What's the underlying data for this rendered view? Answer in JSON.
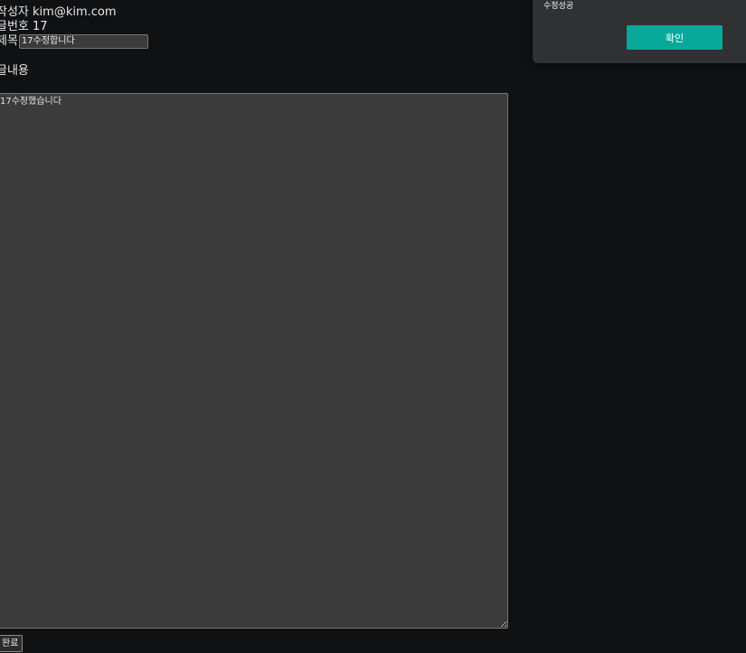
{
  "post": {
    "writer_label": "작성자",
    "writer_value": "kim@kim.com",
    "number_label": "글번호",
    "number_value": "17",
    "title_label": "제목",
    "title_value": "17수정합니다",
    "content_label": "글내용",
    "content_value": "17수정했습니다",
    "submit_label": "완료"
  },
  "dialog": {
    "message": "수정성공",
    "confirm_label": "확인",
    "confirm_color": "#08a89a"
  }
}
